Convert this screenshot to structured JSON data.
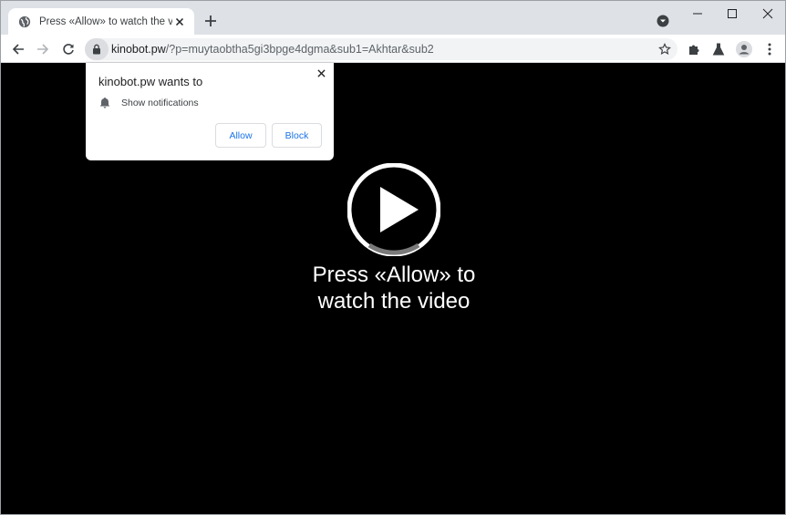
{
  "tab": {
    "title": "Press «Allow» to watch the video",
    "favicon": "globe-icon"
  },
  "toolbar": {
    "url_host": "kinobot.pw",
    "url_path": "/?p=muytaobtha5gi3bpge4dgma&sub1=Akhtar&sub2"
  },
  "popup": {
    "title": "kinobot.pw wants to",
    "permission": "Show notifications",
    "allow_label": "Allow",
    "block_label": "Block"
  },
  "page": {
    "message_line1": "Press «Allow» to",
    "message_line2": "watch the video"
  },
  "colors": {
    "accent": "#1a73e8",
    "tabstrip": "#dee1e6",
    "page_bg": "#000000",
    "omnibox_bg": "#f1f3f4"
  }
}
